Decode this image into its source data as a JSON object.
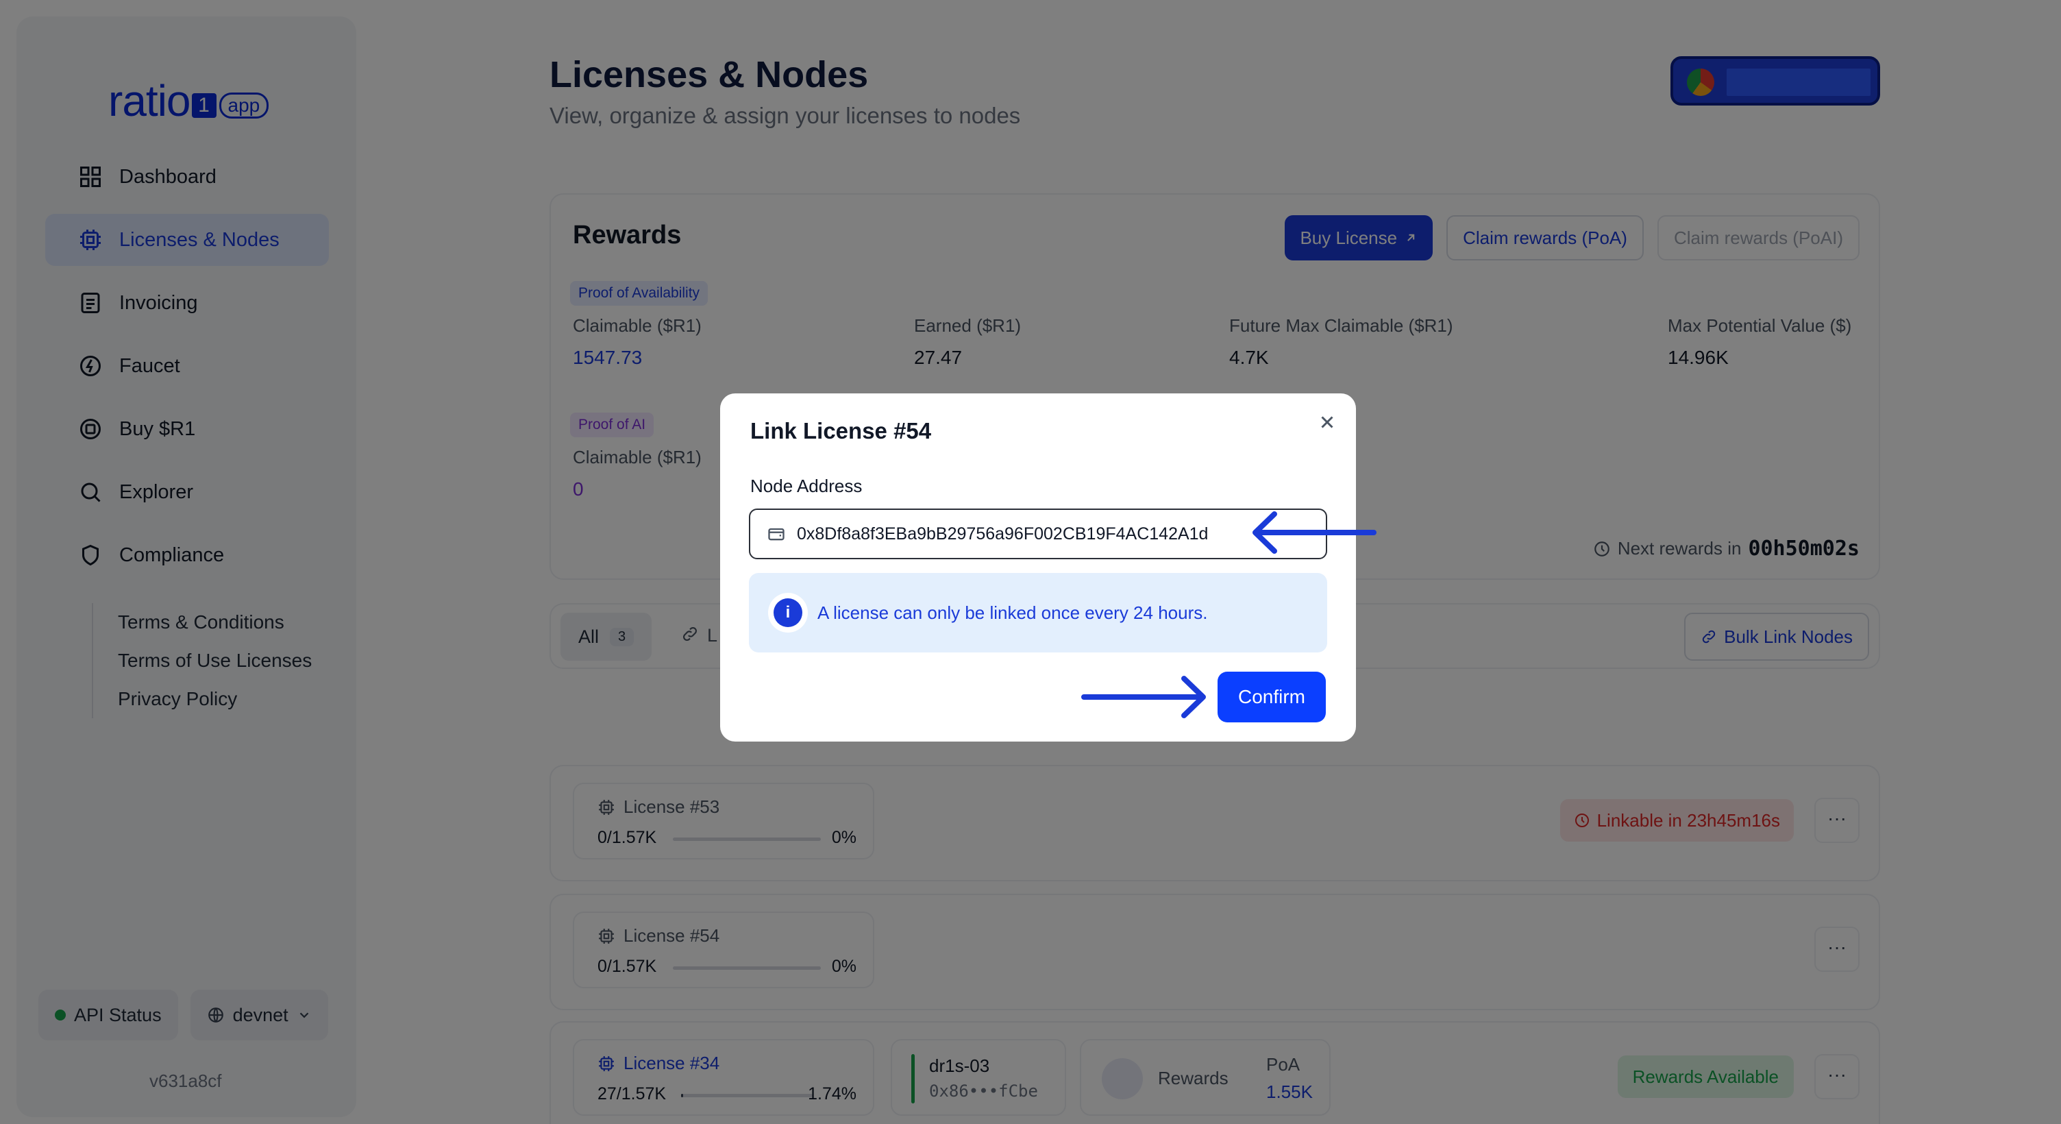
{
  "app": {
    "logo_word": "ratio",
    "logo_mark": "1",
    "logo_tag": "app",
    "accent": "#1a3bd8"
  },
  "sidebar": {
    "items": [
      {
        "label": "Dashboard",
        "icon": "grid-icon"
      },
      {
        "label": "Licenses & Nodes",
        "icon": "chip-icon",
        "active": true
      },
      {
        "label": "Invoicing",
        "icon": "document-icon"
      },
      {
        "label": "Faucet",
        "icon": "bolt-icon"
      },
      {
        "label": "Buy $R1",
        "icon": "coin-icon"
      },
      {
        "label": "Explorer",
        "icon": "search-icon"
      },
      {
        "label": "Compliance",
        "icon": "shield-icon"
      }
    ],
    "compliance_links": [
      "Terms & Conditions",
      "Terms of Use Licenses",
      "Privacy Policy"
    ],
    "api_status": "API Status",
    "network": "devnet",
    "version": "v631a8cf"
  },
  "header": {
    "title": "Licenses & Nodes",
    "subtitle": "View, organize & assign your licenses to nodes"
  },
  "rewards": {
    "title": "Rewards",
    "buy_license": "Buy License",
    "claim_poa": "Claim rewards (PoA)",
    "claim_poai": "Claim rewards (PoAI)",
    "poa_tag": "Proof of Availability",
    "poai_tag": "Proof of AI",
    "claimable_label": "Claimable ($R1)",
    "claimable_value": "1547.73",
    "earned_label": "Earned ($R1)",
    "earned_value": "27.47",
    "future_label": "Future Max Claimable ($R1)",
    "future_value": "4.7K",
    "max_label": "Max Potential Value ($)",
    "max_value": "14.96K",
    "poai_claimable_label": "Claimable ($R1)",
    "poai_claimable_value": "0",
    "next_label": "Next rewards in",
    "next_value": "00h50m02s"
  },
  "filters": {
    "all_label": "All",
    "all_count": "3",
    "linked_label": "L",
    "bulk_link": "Bulk Link Nodes"
  },
  "licenses": [
    {
      "name": "License #53",
      "progress": "0/1.57K",
      "pct": "0%",
      "fill": 0.0,
      "badge": "Linkable in 23h45m16s"
    },
    {
      "name": "License #54",
      "progress": "0/1.57K",
      "pct": "0%",
      "fill": 0.0
    },
    {
      "name": "License #34",
      "progress": "27/1.57K",
      "pct": "1.74%",
      "fill": 0.0174,
      "node_name": "dr1s-03",
      "node_addr": "0x86•••fCbe",
      "rewards_label": "Rewards",
      "poa_label": "PoA",
      "poa_value": "1.55K",
      "badge": "Rewards Available"
    }
  ],
  "more_label": "···",
  "modal": {
    "title": "Link License #54",
    "field_label": "Node Address",
    "address_value": "0x8Df8a8f3EBa9bB29756a96F002CB19F4AC142A1d",
    "info": "A license can only be linked once every 24 hours.",
    "info_icon": "i",
    "confirm": "Confirm"
  }
}
